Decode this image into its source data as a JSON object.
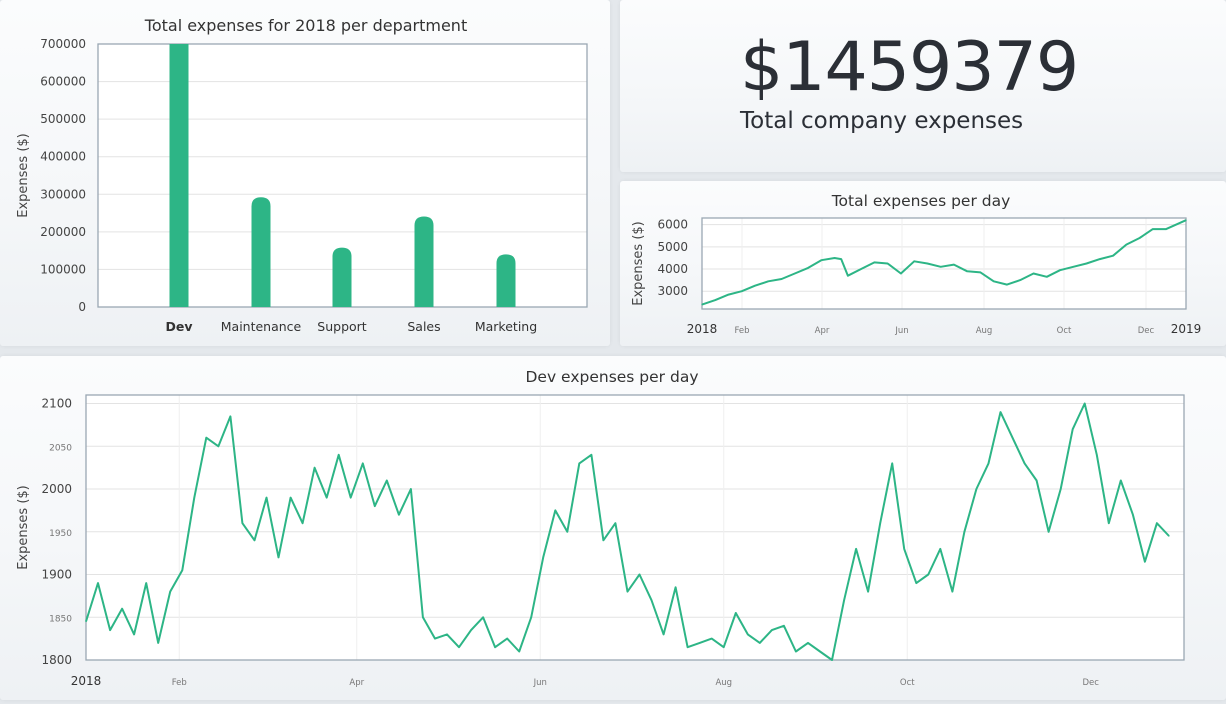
{
  "kpi": {
    "value": "$1459379",
    "label": "Total company expenses"
  },
  "colors": {
    "series": "#2db586",
    "grid": "#e3e3e3",
    "axis": "#9aa7b3"
  },
  "chart_data": [
    {
      "id": "dept",
      "type": "bar",
      "title": "Total expenses for 2018 per department",
      "ylabel": "Expenses ($)",
      "xlabel": "",
      "categories": [
        "Dev",
        "Maintenance",
        "Support",
        "Sales",
        "Marketing"
      ],
      "highlighted_category": "Dev",
      "values": [
        700000,
        292000,
        158000,
        241000,
        140000
      ],
      "ylim": [
        0,
        700000
      ],
      "yticks": [
        "0",
        "100000",
        "200000",
        "300000",
        "400000",
        "500000",
        "600000",
        "700000"
      ],
      "grid": true
    },
    {
      "id": "total",
      "type": "line",
      "title": "Total expenses per day",
      "ylabel": "Expenses ($)",
      "ylim": [
        2200,
        6300
      ],
      "yticks": [
        "3000",
        "4000",
        "5000",
        "6000"
      ],
      "xticks": [
        "2018",
        "Feb",
        "Apr",
        "Jun",
        "Aug",
        "Oct",
        "Dec",
        "2019"
      ],
      "x_points": [
        0,
        10,
        20,
        30,
        40,
        50,
        60,
        70,
        80,
        90,
        100,
        105,
        110,
        120,
        130,
        140,
        150,
        160,
        170,
        180,
        190,
        200,
        210,
        220,
        230,
        240,
        250,
        260,
        270,
        280,
        290,
        300,
        310,
        320,
        330,
        340,
        350,
        365
      ],
      "values": [
        2400,
        2600,
        2850,
        3000,
        3250,
        3450,
        3550,
        3800,
        4050,
        4400,
        4500,
        4450,
        3700,
        4000,
        4300,
        4250,
        3800,
        4350,
        4250,
        4100,
        4200,
        3900,
        3850,
        3450,
        3300,
        3500,
        3800,
        3650,
        3950,
        4100,
        4250,
        4450,
        4600,
        5100,
        5400,
        5800,
        5800,
        6200
      ],
      "grid": true
    },
    {
      "id": "dev",
      "type": "line",
      "title": "Dev expenses per day",
      "ylabel": "Expenses ($)",
      "ylim": [
        1800,
        2110
      ],
      "yticks": [
        "1800",
        "1850",
        "1900",
        "1950",
        "2000",
        "2050",
        "2100"
      ],
      "xticks": [
        "2018",
        "Feb",
        "Apr",
        "Jun",
        "Aug",
        "Oct",
        "Dec"
      ],
      "x_points": [
        0,
        4,
        8,
        12,
        16,
        20,
        24,
        28,
        32,
        36,
        40,
        44,
        48,
        52,
        56,
        60,
        64,
        68,
        72,
        76,
        80,
        84,
        88,
        92,
        96,
        100,
        104,
        108,
        112,
        116,
        120,
        124,
        128,
        132,
        136,
        140,
        144,
        148,
        152,
        156,
        160,
        164,
        168,
        172,
        176,
        180,
        184,
        188,
        192,
        196,
        200,
        204,
        208,
        212,
        216,
        220,
        224,
        228,
        232,
        236,
        240,
        244,
        248,
        252,
        256,
        260,
        264,
        268,
        272,
        276,
        280,
        284,
        288,
        292,
        296,
        300,
        304,
        308,
        312,
        316,
        320,
        324,
        328,
        332,
        336,
        340,
        344,
        348,
        352,
        356,
        360
      ],
      "values": [
        1845,
        1890,
        1835,
        1860,
        1830,
        1890,
        1820,
        1880,
        1905,
        1990,
        2060,
        2050,
        2085,
        1960,
        1940,
        1990,
        1920,
        1990,
        1960,
        2025,
        1990,
        2040,
        1990,
        2030,
        1980,
        2010,
        1970,
        2000,
        1850,
        1825,
        1830,
        1815,
        1835,
        1850,
        1815,
        1825,
        1810,
        1850,
        1920,
        1975,
        1950,
        2030,
        2040,
        1940,
        1960,
        1880,
        1900,
        1870,
        1830,
        1885,
        1815,
        1820,
        1825,
        1815,
        1855,
        1830,
        1820,
        1835,
        1840,
        1810,
        1820,
        1810,
        1800,
        1870,
        1930,
        1880,
        1960,
        2030,
        1930,
        1890,
        1900,
        1930,
        1880,
        1950,
        2000,
        2030,
        2090,
        2060,
        2030,
        2010,
        1950,
        2000,
        2070,
        2100,
        2040,
        1960,
        2010,
        1970,
        1915,
        1960,
        1945
      ],
      "grid": true
    }
  ]
}
